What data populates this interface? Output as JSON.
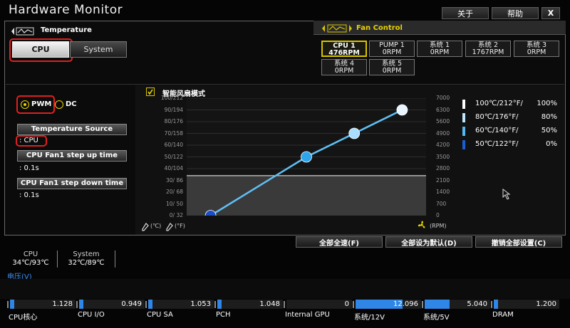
{
  "window": {
    "title": "Hardware Monitor",
    "about": "关于",
    "help": "帮助",
    "close": "X"
  },
  "temperature": {
    "header": "Temperature",
    "tabs": [
      "CPU",
      "System"
    ],
    "mode_pwm": "PWM",
    "mode_dc": "DC",
    "source_label": "Temperature Source",
    "source_value": ": CPU",
    "step_up_label": "CPU Fan1 step up time",
    "step_up_value": ": 0.1s",
    "step_down_label": "CPU Fan1 step down time",
    "step_down_value": ": 0.1s"
  },
  "fan_control": {
    "header": "Fan Control",
    "fans": [
      {
        "name": "CPU 1",
        "rpm": "476RPM",
        "selected": true
      },
      {
        "name": "PUMP 1",
        "rpm": "0RPM"
      },
      {
        "name": "系统 1",
        "rpm": "0RPM"
      },
      {
        "name": "系统 2",
        "rpm": "1767RPM"
      },
      {
        "name": "系统 3",
        "rpm": "0RPM"
      },
      {
        "name": "系统 4",
        "rpm": "0RPM"
      },
      {
        "name": "系统 5",
        "rpm": "0RPM"
      }
    ]
  },
  "smart_fan": {
    "label": "智能风扇模式",
    "unit_c": "(℃)",
    "unit_f": "(°F)",
    "unit_rpm": "(RPM)"
  },
  "chart_data": {
    "type": "line",
    "y_left_ticks": [
      "100/212",
      "90/194",
      "80/176",
      "70/158",
      "60/140",
      "50/122",
      "40/104",
      "30/ 86",
      "20/ 68",
      "10/ 50",
      "0/ 32"
    ],
    "y_right_ticks": [
      "7000",
      "6300",
      "5600",
      "4900",
      "4200",
      "3500",
      "2800",
      "2100",
      "1400",
      "700",
      "0"
    ],
    "x": [
      10,
      50,
      70,
      90
    ],
    "y": [
      0,
      50,
      70,
      90
    ],
    "xlim": [
      0,
      100
    ],
    "ylim": [
      0,
      100
    ],
    "current_temp_line": 34,
    "legend": [
      {
        "label": "100℃/212°F/",
        "pct": "100%",
        "color": "#ffffff"
      },
      {
        "label": "80℃/176°F/",
        "pct": "80%",
        "color": "#bfe6ff"
      },
      {
        "label": "60℃/140°F/",
        "pct": "50%",
        "color": "#55b8f0"
      },
      {
        "label": "50℃/122°F/",
        "pct": "0%",
        "color": "#1a5fd0"
      }
    ]
  },
  "actions": {
    "full_speed": "全部全速(F)",
    "default": "全部设为默认(D)",
    "undo": "撤销全部设置(C)"
  },
  "temps": [
    {
      "name": "CPU",
      "value": "34℃/93℃"
    },
    {
      "name": "System",
      "value": "32℃/89℃"
    }
  ],
  "voltage": {
    "label": "电压(V)",
    "items": [
      {
        "name": "CPU核心",
        "value": "1.128",
        "fill": 0.06
      },
      {
        "name": "CPU I/O",
        "value": "0.949",
        "fill": 0.06
      },
      {
        "name": "CPU SA",
        "value": "1.053",
        "fill": 0.06
      },
      {
        "name": "PCH",
        "value": "1.048",
        "fill": 0.06
      },
      {
        "name": "Internal GPU",
        "value": "0",
        "fill": 0.0
      },
      {
        "name": "系统/12V",
        "value": "12.096",
        "fill": 0.72
      },
      {
        "name": "系统/5V",
        "value": "5.040",
        "fill": 0.38
      },
      {
        "name": "DRAM",
        "value": "1.200",
        "fill": 0.06
      }
    ]
  }
}
